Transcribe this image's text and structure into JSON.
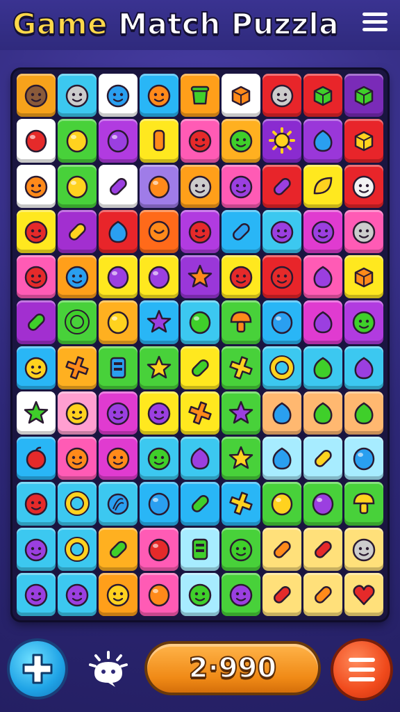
{
  "header": {
    "title_word1": "Game",
    "title_word2": "Match Puzzla"
  },
  "footer": {
    "score": "2·990"
  },
  "icons": {
    "menu": "menu-icon",
    "add": "plus-icon",
    "mascot": "creature-icon",
    "list": "list-icon"
  },
  "colors": {
    "background": "#2e2878",
    "title_yellow": "#ffd84a",
    "score_pill": "#f08a16",
    "add_button": "#1fa3e6",
    "list_button": "#f04a1c"
  },
  "board": {
    "rows": [
      [
        [
          "#f7a21b",
          "face-brown"
        ],
        [
          "#3cc8f0",
          "face-boy"
        ],
        [
          "#ffffff",
          "face-blue"
        ],
        [
          "#29b6f6",
          "face-orange"
        ],
        [
          "#ff9f1a",
          "pot-green"
        ],
        [
          "#ffffff",
          "cube-orange"
        ],
        [
          "#e8252a",
          "face-boy"
        ],
        [
          "#e8252a",
          "cube-green"
        ],
        [
          "#7a2bb8",
          "cube-green"
        ]
      ],
      [
        [
          "#ffffff",
          "gem-red"
        ],
        [
          "#48d13a",
          "gem-yellow"
        ],
        [
          "#b13be0",
          "gem-purple"
        ],
        [
          "#ffe81f",
          "bar-orange"
        ],
        [
          "#ff5bb5",
          "face-red"
        ],
        [
          "#ffb020",
          "face-green"
        ],
        [
          "#8a2bd0",
          "sun-yellow"
        ],
        [
          "#9a37d9",
          "drop-blue"
        ],
        [
          "#e8252a",
          "cube-yellow"
        ]
      ],
      [
        [
          "#ffffff",
          "face-orange"
        ],
        [
          "#48d13a",
          "gem-yellow"
        ],
        [
          "#ffffff",
          "capsule-purple"
        ],
        [
          "#9f7ce8",
          "gem-orange"
        ],
        [
          "#ff9f1a",
          "face-boy"
        ],
        [
          "#ff5bb5",
          "face-purple"
        ],
        [
          "#e8252a",
          "capsule-purple"
        ],
        [
          "#ffe81f",
          "leaf-yellow"
        ],
        [
          "#e8252a",
          "face-white"
        ]
      ],
      [
        [
          "#ffe81f",
          "face-red"
        ],
        [
          "#a22fd0",
          "capsule-yellow"
        ],
        [
          "#e8252a",
          "drop-blue"
        ],
        [
          "#ff6a1a",
          "coin-orange"
        ],
        [
          "#b13be0",
          "face-red"
        ],
        [
          "#29b6f6",
          "capsule-blue"
        ],
        [
          "#3cc8f0",
          "face-purple"
        ],
        [
          "#e03bd0",
          "face-purple"
        ],
        [
          "#ff5bb5",
          "face-boy"
        ]
      ],
      [
        [
          "#ff5bb5",
          "face-red"
        ],
        [
          "#ff9f1a",
          "face-blue"
        ],
        [
          "#ffe81f",
          "gem-purple"
        ],
        [
          "#ffe81f",
          "gem-purple"
        ],
        [
          "#9a37d9",
          "star-orange"
        ],
        [
          "#ffe81f",
          "face-red"
        ],
        [
          "#e8252a",
          "face-red"
        ],
        [
          "#ff5bb5",
          "drop-purple"
        ],
        [
          "#ffe81f",
          "cube-orange"
        ]
      ],
      [
        [
          "#a22fd0",
          "capsule-green"
        ],
        [
          "#48d13a",
          "ring-green"
        ],
        [
          "#ffb020",
          "gem-yellow"
        ],
        [
          "#29b6f6",
          "star-purple"
        ],
        [
          "#3cc8f0",
          "gem-green"
        ],
        [
          "#48d13a",
          "mushroom-orange"
        ],
        [
          "#29b6f6",
          "gem-blue"
        ],
        [
          "#e03bd0",
          "drop-purple"
        ],
        [
          "#b13be0",
          "face-green"
        ]
      ],
      [
        [
          "#29b6f6",
          "face-yellow"
        ],
        [
          "#ffb020",
          "cross-orange"
        ],
        [
          "#48d13a",
          "box-blue"
        ],
        [
          "#48d13a",
          "star-yellow"
        ],
        [
          "#ffe81f",
          "capsule-green"
        ],
        [
          "#48d13a",
          "cross-yellow"
        ],
        [
          "#3cc8f0",
          "ring-yellow"
        ],
        [
          "#3cc8f0",
          "drop-green"
        ],
        [
          "#3cc8f0",
          "drop-purple"
        ]
      ],
      [
        [
          "#ffffff",
          "star-green"
        ],
        [
          "#ff9fd0",
          "face-yellow"
        ],
        [
          "#e03bd0",
          "face-purple"
        ],
        [
          "#ffe81f",
          "face-purple"
        ],
        [
          "#ffe81f",
          "cross-orange"
        ],
        [
          "#48d13a",
          "star-purple"
        ],
        [
          "#ffb870",
          "drop-blue"
        ],
        [
          "#ffb870",
          "drop-green"
        ],
        [
          "#ffb870",
          "drop-green"
        ]
      ],
      [
        [
          "#29b6f6",
          "fruit-red"
        ],
        [
          "#ff5bb5",
          "face-orange"
        ],
        [
          "#e03bd0",
          "face-orange"
        ],
        [
          "#3cc8f0",
          "face-green"
        ],
        [
          "#3cc8f0",
          "drop-purple"
        ],
        [
          "#48d13a",
          "star-yellow"
        ],
        [
          "#a7ecff",
          "drop-blue"
        ],
        [
          "#a7ecff",
          "capsule-yellow"
        ],
        [
          "#a7ecff",
          "gem-blue"
        ]
      ],
      [
        [
          "#3cc8f0",
          "face-red"
        ],
        [
          "#3cc8f0",
          "ring-yellow"
        ],
        [
          "#3cc8f0",
          "shell-blue"
        ],
        [
          "#29b6f6",
          "gem-blue"
        ],
        [
          "#29b6f6",
          "capsule-green"
        ],
        [
          "#29b6f6",
          "cross-yellow"
        ],
        [
          "#48d13a",
          "gem-yellow"
        ],
        [
          "#48d13a",
          "gem-purple"
        ],
        [
          "#48d13a",
          "mushroom-yellow"
        ]
      ],
      [
        [
          "#3cc8f0",
          "face-purple"
        ],
        [
          "#3cc8f0",
          "ring-yellow"
        ],
        [
          "#ffb020",
          "capsule-green"
        ],
        [
          "#ff5bb5",
          "gem-red"
        ],
        [
          "#a7ecff",
          "box-green"
        ],
        [
          "#48d13a",
          "face-green"
        ],
        [
          "#ffe07a",
          "capsule-orange"
        ],
        [
          "#ffe07a",
          "capsule-red"
        ],
        [
          "#ffe07a",
          "face-boy"
        ]
      ],
      [
        [
          "#3cc8f0",
          "face-purple"
        ],
        [
          "#3cc8f0",
          "face-purple"
        ],
        [
          "#ff9f1a",
          "face-yellow"
        ],
        [
          "#ff5bb5",
          "gem-orange"
        ],
        [
          "#a7ecff",
          "face-green"
        ],
        [
          "#48d13a",
          "face-purple"
        ],
        [
          "#ffe07a",
          "capsule-red"
        ],
        [
          "#ffe07a",
          "capsule-orange"
        ],
        [
          "#ffe07a",
          "heart-red"
        ]
      ]
    ]
  }
}
